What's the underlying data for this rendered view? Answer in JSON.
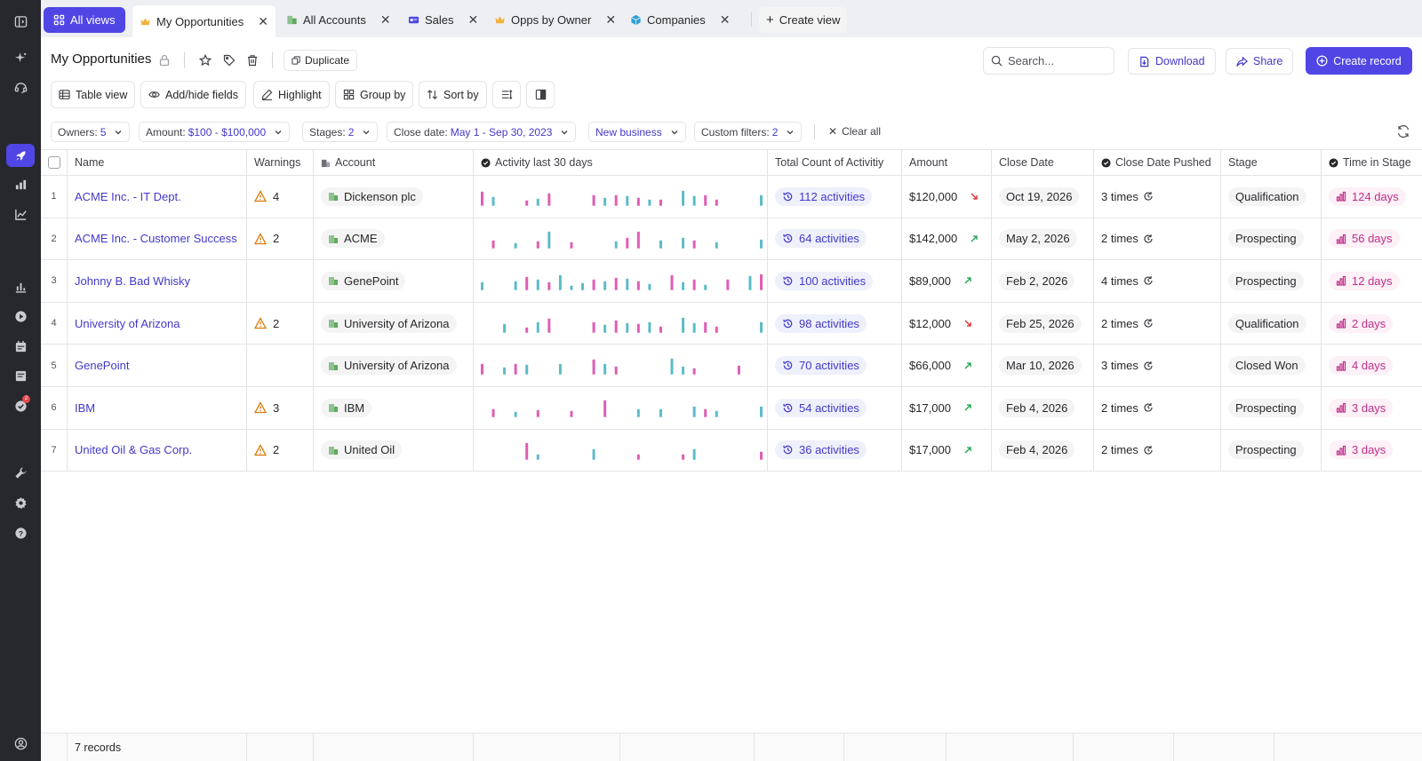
{
  "tabs": {
    "all_views": "All views",
    "items": [
      {
        "label": "My Opportunities",
        "icon": "crown-icon"
      },
      {
        "label": "All Accounts",
        "icon": "building-icon"
      },
      {
        "label": "Sales",
        "icon": "card-icon"
      },
      {
        "label": "Opps by Owner",
        "icon": "crown-icon"
      },
      {
        "label": "Companies",
        "icon": "cube-icon"
      }
    ],
    "create_view": "Create view"
  },
  "header": {
    "title": "My Opportunities",
    "duplicate": "Duplicate",
    "search_placeholder": "Search...",
    "download": "Download",
    "share": "Share",
    "create_record": "Create record"
  },
  "toolbar": {
    "table_view": "Table view",
    "add_hide_fields": "Add/hide fields",
    "highlight": "Highlight",
    "group_by": "Group by",
    "sort_by": "Sort by"
  },
  "filters": [
    {
      "label": "Owners:",
      "value": "5"
    },
    {
      "label": "Amount:",
      "value": "$100 - $100,000"
    },
    {
      "label": "Stages:",
      "value": "2"
    },
    {
      "label": "Close date:",
      "value": "May 1 - Sep 30, 2023"
    },
    {
      "label": "",
      "value": "New business"
    },
    {
      "label": "Custom filters:",
      "value": "2"
    }
  ],
  "clear_all": "Clear all",
  "columns": {
    "name": "Name",
    "warnings": "Warnings",
    "account": "Account",
    "activity": "Activity last 30 days",
    "total": "Total Count of Activitiy",
    "amount": "Amount",
    "close_date": "Close Date",
    "pushed": "Close Date Pushed",
    "stage": "Stage",
    "time": "Time in Stage"
  },
  "colors": {
    "accent": "#5046e5",
    "link": "#4338ca",
    "spark_pink": "#e05db5",
    "spark_teal": "#5bbcc9",
    "up": "#16a34a",
    "down": "#dc2626",
    "warn": "#d97706"
  },
  "rows": [
    {
      "num": "1",
      "name": "ACME Inc. - IT Dept.",
      "warnings": "4",
      "account": "Dickenson plc",
      "activities": "112 activities",
      "amount": "$120,000",
      "trend": "down",
      "close": "Oct 19, 2026",
      "pushed": "3 times",
      "stage": "Qualification",
      "time": "124 days",
      "spark": [
        [
          0,
          16,
          "p"
        ],
        [
          1,
          10,
          "t"
        ],
        [
          4,
          6,
          "p"
        ],
        [
          5,
          8,
          "t"
        ],
        [
          6,
          14,
          "p"
        ],
        [
          10,
          12,
          "p"
        ],
        [
          11,
          9,
          "t"
        ],
        [
          12,
          12,
          "p"
        ],
        [
          13,
          11,
          "t"
        ],
        [
          14,
          9,
          "p"
        ],
        [
          15,
          7,
          "t"
        ],
        [
          16,
          7,
          "p"
        ],
        [
          18,
          17,
          "t"
        ],
        [
          19,
          11,
          "t"
        ],
        [
          20,
          12,
          "p"
        ],
        [
          21,
          7,
          "p"
        ],
        [
          25,
          12,
          "t"
        ]
      ]
    },
    {
      "num": "2",
      "name": "ACME Inc. - Customer Success",
      "warnings": "2",
      "account": "ACME",
      "activities": "64 activities",
      "amount": "$142,000",
      "trend": "up",
      "close": "May 2, 2026",
      "pushed": "2 times",
      "stage": "Prospecting",
      "time": "56 days",
      "spark": [
        [
          1,
          9,
          "p"
        ],
        [
          3,
          6,
          "t"
        ],
        [
          5,
          8,
          "p"
        ],
        [
          6,
          19,
          "t"
        ],
        [
          8,
          7,
          "p"
        ],
        [
          12,
          8,
          "t"
        ],
        [
          13,
          12,
          "p"
        ],
        [
          14,
          19,
          "p"
        ],
        [
          16,
          9,
          "t"
        ],
        [
          18,
          12,
          "t"
        ],
        [
          19,
          9,
          "p"
        ],
        [
          21,
          7,
          "t"
        ],
        [
          25,
          10,
          "t"
        ]
      ]
    },
    {
      "num": "3",
      "name": "Johnny B. Bad Whisky",
      "warnings": "",
      "account": "GenePoint",
      "activities": "100 activities",
      "amount": "$89,000",
      "trend": "up",
      "close": "Feb 2, 2026",
      "pushed": "4 times",
      "stage": "Prospecting",
      "time": "12 days",
      "spark": [
        [
          0,
          9,
          "t"
        ],
        [
          3,
          10,
          "t"
        ],
        [
          4,
          15,
          "p"
        ],
        [
          5,
          12,
          "t"
        ],
        [
          6,
          9,
          "p"
        ],
        [
          7,
          17,
          "t"
        ],
        [
          8,
          5,
          "t"
        ],
        [
          9,
          8,
          "t"
        ],
        [
          10,
          12,
          "p"
        ],
        [
          11,
          10,
          "t"
        ],
        [
          12,
          14,
          "p"
        ],
        [
          13,
          13,
          "t"
        ],
        [
          14,
          10,
          "p"
        ],
        [
          15,
          7,
          "t"
        ],
        [
          17,
          17,
          "p"
        ],
        [
          18,
          9,
          "t"
        ],
        [
          19,
          12,
          "p"
        ],
        [
          20,
          6,
          "t"
        ],
        [
          22,
          12,
          "p"
        ],
        [
          24,
          16,
          "t"
        ],
        [
          25,
          18,
          "p"
        ]
      ]
    },
    {
      "num": "4",
      "name": "University of Arizona",
      "warnings": "2",
      "account": "University of Arizona",
      "activities": "98 activities",
      "amount": "$12,000",
      "trend": "down",
      "close": "Feb 25, 2026",
      "pushed": "2 times",
      "stage": "Qualification",
      "time": "2 days",
      "spark": [
        [
          2,
          10,
          "t"
        ],
        [
          4,
          6,
          "p"
        ],
        [
          5,
          12,
          "t"
        ],
        [
          6,
          16,
          "p"
        ],
        [
          10,
          12,
          "p"
        ],
        [
          11,
          9,
          "t"
        ],
        [
          12,
          14,
          "p"
        ],
        [
          13,
          11,
          "t"
        ],
        [
          14,
          10,
          "p"
        ],
        [
          15,
          12,
          "t"
        ],
        [
          16,
          7,
          "p"
        ],
        [
          18,
          17,
          "t"
        ],
        [
          19,
          11,
          "t"
        ],
        [
          20,
          12,
          "p"
        ],
        [
          21,
          7,
          "p"
        ],
        [
          25,
          12,
          "t"
        ]
      ]
    },
    {
      "num": "5",
      "name": "GenePoint",
      "warnings": "",
      "account": "University of Arizona",
      "activities": "70 activities",
      "amount": "$66,000",
      "trend": "up",
      "close": "Mar 10, 2026",
      "pushed": "3 times",
      "stage": "Closed Won",
      "time": "4 days",
      "spark": [
        [
          0,
          12,
          "p"
        ],
        [
          2,
          8,
          "t"
        ],
        [
          3,
          12,
          "p"
        ],
        [
          4,
          11,
          "t"
        ],
        [
          7,
          12,
          "t"
        ],
        [
          10,
          17,
          "p"
        ],
        [
          11,
          12,
          "t"
        ],
        [
          12,
          9,
          "p"
        ],
        [
          17,
          18,
          "t"
        ],
        [
          18,
          9,
          "t"
        ],
        [
          19,
          7,
          "p"
        ],
        [
          23,
          10,
          "p"
        ]
      ]
    },
    {
      "num": "6",
      "name": "IBM",
      "warnings": "3",
      "account": "IBM",
      "activities": "54 activities",
      "amount": "$17,000",
      "trend": "up",
      "close": "Feb 4, 2026",
      "pushed": "2 times",
      "stage": "Prospecting",
      "time": "3 days",
      "spark": [
        [
          1,
          9,
          "p"
        ],
        [
          3,
          6,
          "t"
        ],
        [
          5,
          8,
          "p"
        ],
        [
          8,
          7,
          "p"
        ],
        [
          11,
          19,
          "p"
        ],
        [
          14,
          9,
          "t"
        ],
        [
          16,
          9,
          "t"
        ],
        [
          19,
          12,
          "t"
        ],
        [
          20,
          9,
          "p"
        ],
        [
          21,
          7,
          "t"
        ],
        [
          25,
          12,
          "t"
        ]
      ]
    },
    {
      "num": "7",
      "name": "United Oil & Gas Corp.",
      "warnings": "2",
      "account": "United Oil",
      "activities": "36 activities",
      "amount": "$17,000",
      "trend": "up",
      "close": "Feb 4, 2026",
      "pushed": "2 times",
      "stage": "Prospecting",
      "time": "3 days",
      "spark": [
        [
          4,
          19,
          "p"
        ],
        [
          5,
          6,
          "t"
        ],
        [
          10,
          12,
          "t"
        ],
        [
          14,
          6,
          "p"
        ],
        [
          18,
          6,
          "p"
        ],
        [
          19,
          12,
          "t"
        ],
        [
          25,
          9,
          "p"
        ]
      ]
    }
  ],
  "footer": {
    "count": "7 records"
  }
}
